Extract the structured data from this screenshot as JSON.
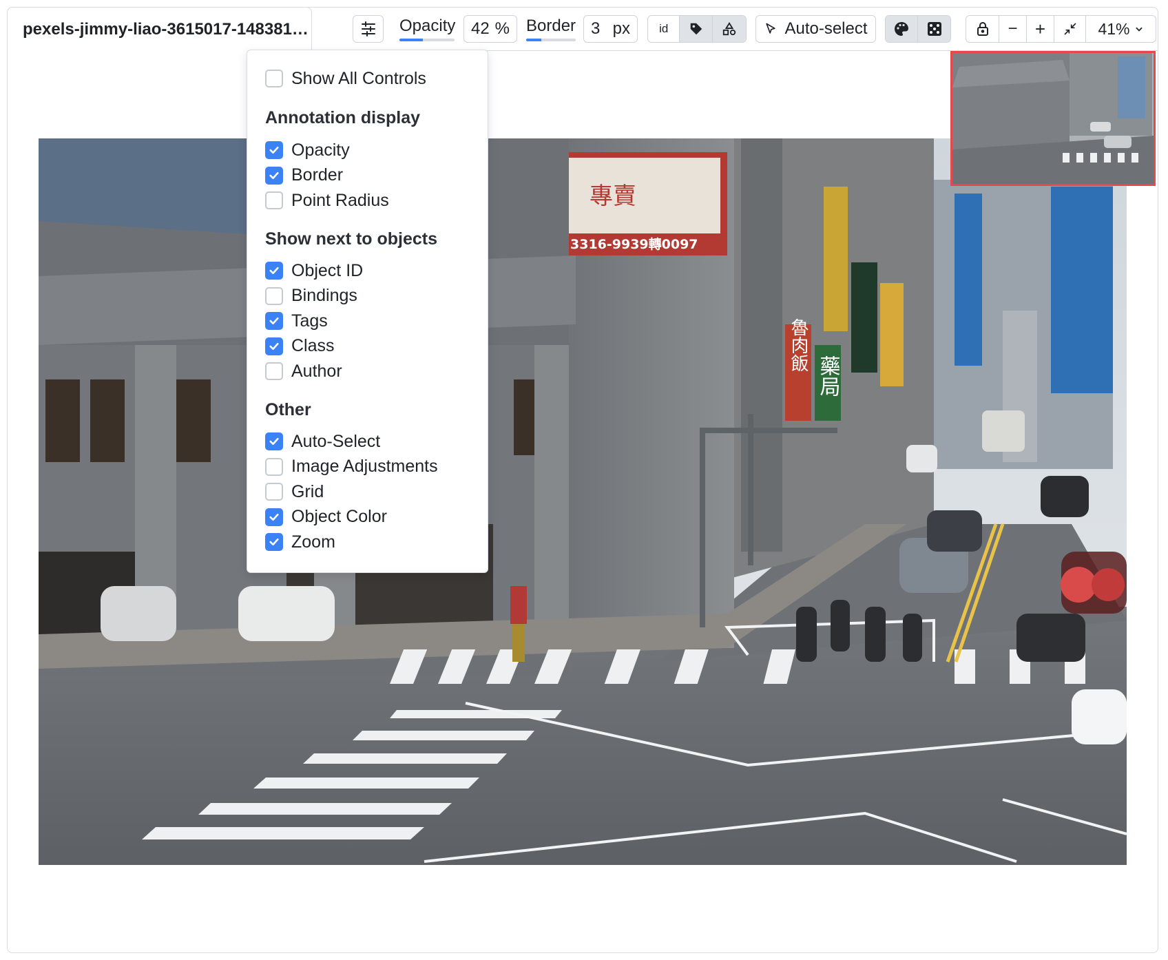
{
  "tab": {
    "title": "pexels-jimmy-liao-3615017-148381…"
  },
  "toolbar": {
    "opacity_label": "Opacity",
    "opacity_value": "42",
    "opacity_unit": "%",
    "opacity_fraction": 0.42,
    "border_label": "Border",
    "border_value": "3",
    "border_unit": "px",
    "border_fraction": 0.3,
    "id_label": "id",
    "auto_select_label": "Auto-select",
    "zoom_out_label": "−",
    "zoom_in_label": "+",
    "zoom_value": "41%"
  },
  "menu": {
    "show_all": {
      "label": "Show All Controls",
      "checked": false
    },
    "annotation_display": {
      "heading": "Annotation display",
      "items": [
        {
          "label": "Opacity",
          "checked": true
        },
        {
          "label": "Border",
          "checked": true
        },
        {
          "label": "Point Radius",
          "checked": false
        }
      ]
    },
    "show_next": {
      "heading": "Show next to objects",
      "items": [
        {
          "label": "Object ID",
          "checked": true
        },
        {
          "label": "Bindings",
          "checked": false
        },
        {
          "label": "Tags",
          "checked": true
        },
        {
          "label": "Class",
          "checked": true
        },
        {
          "label": "Author",
          "checked": false
        }
      ]
    },
    "other": {
      "heading": "Other",
      "items": [
        {
          "label": "Auto-Select",
          "checked": true
        },
        {
          "label": "Image Adjustments",
          "checked": false
        },
        {
          "label": "Grid",
          "checked": false
        },
        {
          "label": "Object Color",
          "checked": true
        },
        {
          "label": "Zoom",
          "checked": true
        }
      ]
    }
  },
  "image_signs": {
    "phone": "3316-9939轉0097",
    "billboard": "專賣",
    "pharmacy": "藥局",
    "restaurant": "魯肉飯"
  },
  "colors": {
    "accent": "#3b82f6",
    "minimap_border": "#e5484d",
    "active_segment": "#dfe3e8"
  }
}
